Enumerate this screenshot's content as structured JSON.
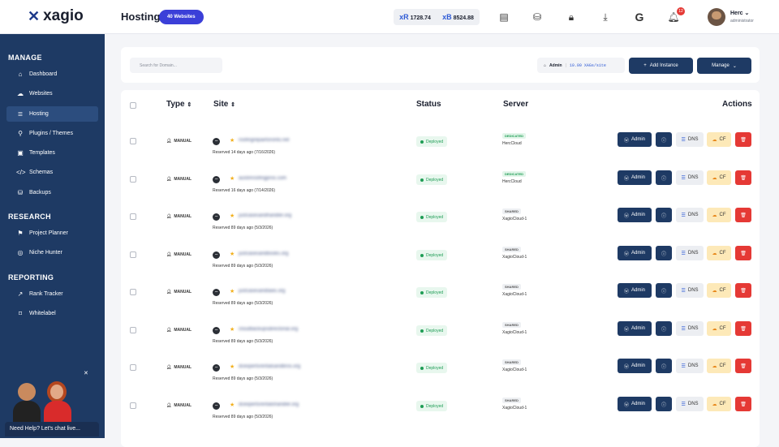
{
  "brand": {
    "name": "xagio"
  },
  "header": {
    "title": "Hosting",
    "sites_badge": "40 Websites",
    "balance_1_symbol": "xR",
    "balance_1": "1728.74",
    "balance_2_symbol": "xB",
    "balance_2": "8524.88",
    "notification_count": "12",
    "user_name": "Herc",
    "user_role": "administrator",
    "icons": [
      "document-icon",
      "database-icon",
      "lock-icon",
      "download-icon",
      "google-icon",
      "bell-icon"
    ]
  },
  "sidebar": {
    "manage_title": "MANAGE",
    "research_title": "RESEARCH",
    "reporting_title": "REPORTING",
    "manage_items": [
      {
        "label": "Dashboard",
        "icon": "home-icon"
      },
      {
        "label": "Websites",
        "icon": "cloud-icon"
      },
      {
        "label": "Hosting",
        "icon": "server-icon"
      },
      {
        "label": "Plugins / Themes",
        "icon": "plugin-icon"
      },
      {
        "label": "Templates",
        "icon": "template-icon"
      },
      {
        "label": "Schemas",
        "icon": "code-icon"
      },
      {
        "label": "Backups",
        "icon": "database-icon"
      }
    ],
    "research_items": [
      {
        "label": "Project Planner",
        "icon": "pin-icon"
      },
      {
        "label": "Niche Hunter",
        "icon": "target-icon"
      }
    ],
    "reporting_items": [
      {
        "label": "Rank Tracker",
        "icon": "chart-icon"
      },
      {
        "label": "Whitelabel",
        "icon": "bookmark-icon"
      }
    ],
    "help_text": "Need Help? Let's chat live..."
  },
  "toolbar": {
    "search_placeholder": "Search for Domain...",
    "price_role": "Admin",
    "price_value": "10.00 XAGs/site",
    "add_instance": "Add Instance",
    "manage": "Manage"
  },
  "table": {
    "headers": {
      "type": "Type",
      "site": "Site",
      "status": "Status",
      "server": "Server",
      "actions": "Actions"
    },
    "action_labels": {
      "admin": "Admin",
      "dns": "DNS",
      "cf": "CF"
    },
    "rows": [
      {
        "type": "MANUAL",
        "domain": "roofingrepairtoronto.net",
        "reserved": "Reserved 14 days ago (7/16/2026)",
        "status": "Deployed",
        "server_type": "DEDICATED",
        "server_name": "HercCloud"
      },
      {
        "type": "MANUAL",
        "domain": "austinroofingpros.com",
        "reserved": "Reserved 16 days ago (7/14/2026)",
        "status": "Deployed",
        "server_type": "DEDICATED",
        "server_name": "HercCloud"
      },
      {
        "type": "MANUAL",
        "domain": "justcasesandhandler.org",
        "reserved": "Reserved 89 days ago (5/3/2026)",
        "status": "Deployed",
        "server_type": "SHARED",
        "server_name": "XagioCloud-1"
      },
      {
        "type": "MANUAL",
        "domain": "justcasesandbooks.org",
        "reserved": "Reserved 89 days ago (5/3/2026)",
        "status": "Deployed",
        "server_type": "SHARED",
        "server_name": "XagioCloud-1"
      },
      {
        "type": "MANUAL",
        "domain": "justcasesandlaws.org",
        "reserved": "Reserved 89 days ago (5/3/2026)",
        "status": "Deployed",
        "server_type": "SHARED",
        "server_name": "XagioCloud-1"
      },
      {
        "type": "MANUAL",
        "domain": "cloudbackupsdirectorial.org",
        "reserved": "Reserved 89 days ago (5/3/2026)",
        "status": "Deployed",
        "server_type": "SHARED",
        "server_name": "XagioCloud-1"
      },
      {
        "type": "MANUAL",
        "domain": "dcexpertsrentalsandbros.org",
        "reserved": "Reserved 89 days ago (5/3/2026)",
        "status": "Deployed",
        "server_type": "SHARED",
        "server_name": "XagioCloud-1"
      },
      {
        "type": "MANUAL",
        "domain": "dcexpertsrentalshandler.org",
        "reserved": "Reserved 89 days ago (5/3/2026)",
        "status": "Deployed",
        "server_type": "SHARED",
        "server_name": "XagioCloud-1"
      }
    ]
  }
}
